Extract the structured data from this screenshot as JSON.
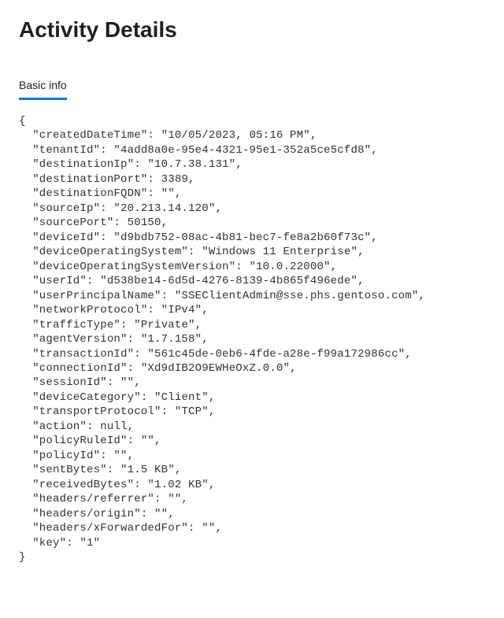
{
  "page": {
    "title": "Activity Details"
  },
  "tabs": {
    "basic": "Basic info"
  },
  "details": {
    "createdDateTime": "10/05/2023, 05:16 PM",
    "tenantId": "4add8a0e-95e4-4321-95e1-352a5ce5cfd8",
    "destinationIp": "10.7.38.131",
    "destinationPort": 3389,
    "destinationFQDN": "",
    "sourceIp": "20.213.14.120",
    "sourcePort": 50150,
    "deviceId": "d9bdb752-08ac-4b81-bec7-fe8a2b60f73c",
    "deviceOperatingSystem": "Windows 11 Enterprise",
    "deviceOperatingSystemVersion": "10.0.22000",
    "userId": "d538be14-6d5d-4276-8139-4b865f496ede",
    "userPrincipalName": "SSEClientAdmin@sse.phs.gentoso.com",
    "networkProtocol": "IPv4",
    "trafficType": "Private",
    "agentVersion": "1.7.158",
    "transactionId": "561c45de-0eb6-4fde-a28e-f99a172986cc",
    "connectionId": "Xd9dIB2O9EWHeOxZ.0.0",
    "sessionId": "",
    "deviceCategory": "Client",
    "transportProtocol": "TCP",
    "action": null,
    "policyRuleId": "",
    "policyId": "",
    "sentBytes": "1.5 KB",
    "receivedBytes": "1.02 KB",
    "headers/referrer": "",
    "headers/origin": "",
    "headers/xForwardedFor": "",
    "key": "1"
  },
  "detailsOrder": [
    "createdDateTime",
    "tenantId",
    "destinationIp",
    "destinationPort",
    "destinationFQDN",
    "sourceIp",
    "sourcePort",
    "deviceId",
    "deviceOperatingSystem",
    "deviceOperatingSystemVersion",
    "userId",
    "userPrincipalName",
    "networkProtocol",
    "trafficType",
    "agentVersion",
    "transactionId",
    "connectionId",
    "sessionId",
    "deviceCategory",
    "transportProtocol",
    "action",
    "policyRuleId",
    "policyId",
    "sentBytes",
    "receivedBytes",
    "headers/referrer",
    "headers/origin",
    "headers/xForwardedFor",
    "key"
  ]
}
